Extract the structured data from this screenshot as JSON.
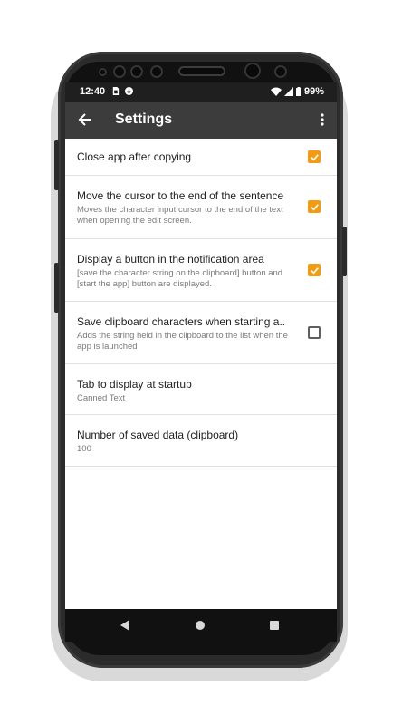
{
  "status_bar": {
    "time": "12:40",
    "battery": "99%",
    "icons": [
      "sim-card-icon",
      "download-icon",
      "wifi-icon",
      "cell-signal-icon",
      "battery-icon"
    ]
  },
  "toolbar": {
    "title": "Settings",
    "back_icon": "arrow-back-icon",
    "menu_icon": "more-vert-icon"
  },
  "settings": [
    {
      "title": "Close app after copying",
      "summary": "",
      "checked": true
    },
    {
      "title": "Move the cursor to the end of the sentence",
      "summary": "Moves the character input cursor to the end of the text when opening the edit screen.",
      "checked": true
    },
    {
      "title": "Display a button in the notification area",
      "summary": "[save the character string on the clipboard] button and [start the app] button are displayed.",
      "checked": true
    },
    {
      "title": "Save clipboard characters when starting a..",
      "summary": "Adds the string held in the clipboard to the list when the app is launched",
      "checked": false
    }
  ],
  "preferences": [
    {
      "title": "Tab to display at startup",
      "summary": "Canned Text"
    },
    {
      "title": "Number of saved data (clipboard)",
      "summary": "100"
    }
  ],
  "nav_bar": {
    "icons": [
      "nav-back-icon",
      "nav-home-icon",
      "nav-recents-icon"
    ]
  },
  "colors": {
    "accent": "#f39c12",
    "toolbar": "#3c3c3c",
    "status_bar": "#1f1f1f"
  }
}
